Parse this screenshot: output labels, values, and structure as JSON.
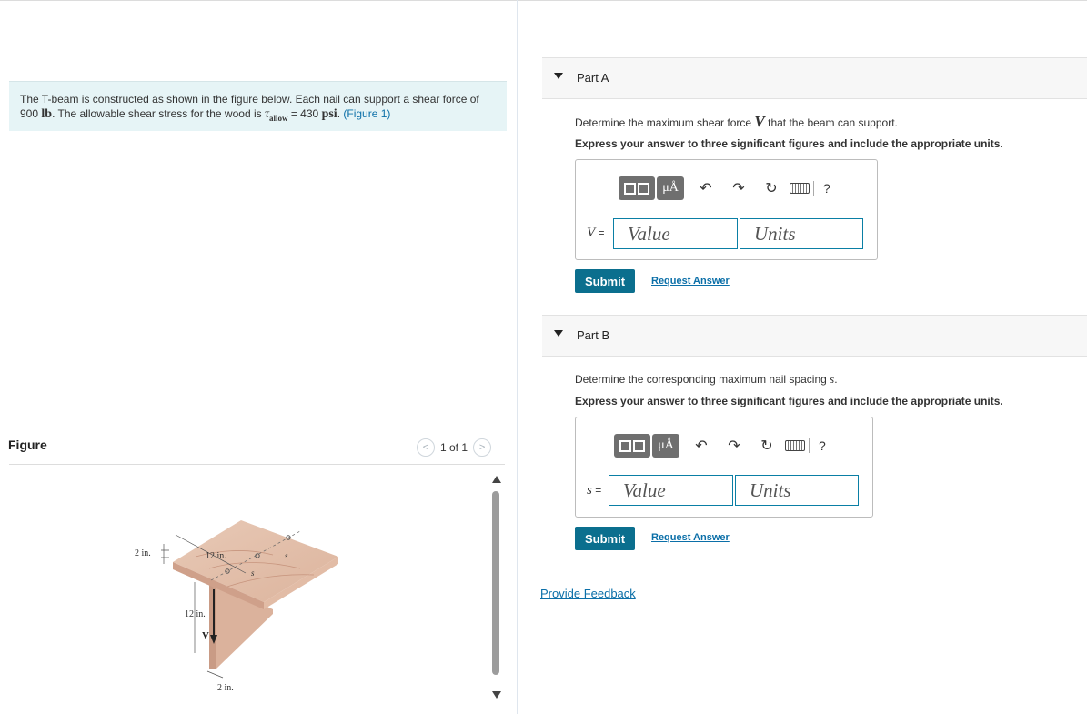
{
  "problem": {
    "text1": "The T-beam is constructed as shown in the figure below. Each nail can support a shear force of",
    "force_value": "900",
    "force_unit": "lb",
    "text2": ". The allowable shear stress for the wood is",
    "tau_symbol": "τ",
    "tau_sub": "allow",
    "equals": "= 430",
    "stress_unit": "psi",
    "period": ".",
    "figure_link": "(Figure 1)"
  },
  "figure": {
    "title": "Figure",
    "pager": "1 of 1",
    "prev": "<",
    "next": ">",
    "labels": {
      "top_thickness": "2 in.",
      "flange_width": "12 in.",
      "web_height": "12 in.",
      "web_thickness": "2 in.",
      "shear": "V",
      "spacing": "s"
    }
  },
  "part_a": {
    "label": "Part A",
    "question_pre": "Determine the maximum shear force",
    "question_var": "V",
    "question_post": "that the beam can support.",
    "instruction": "Express your answer to three significant figures and include the appropriate units.",
    "var_label": "V",
    "eq": "=",
    "value_placeholder": "Value",
    "units_placeholder": "Units",
    "submit": "Submit",
    "request": "Request Answer"
  },
  "part_b": {
    "label": "Part B",
    "question_pre": "Determine the corresponding maximum nail spacing",
    "question_var": "s",
    "question_post": ".",
    "instruction": "Express your answer to three significant figures and include the appropriate units.",
    "var_label": "s",
    "eq": "=",
    "value_placeholder": "Value",
    "units_placeholder": "Units",
    "submit": "Submit",
    "request": "Request Answer"
  },
  "toolbar": {
    "units_button": "μÅ",
    "help": "?"
  },
  "feedback": "Provide Feedback"
}
